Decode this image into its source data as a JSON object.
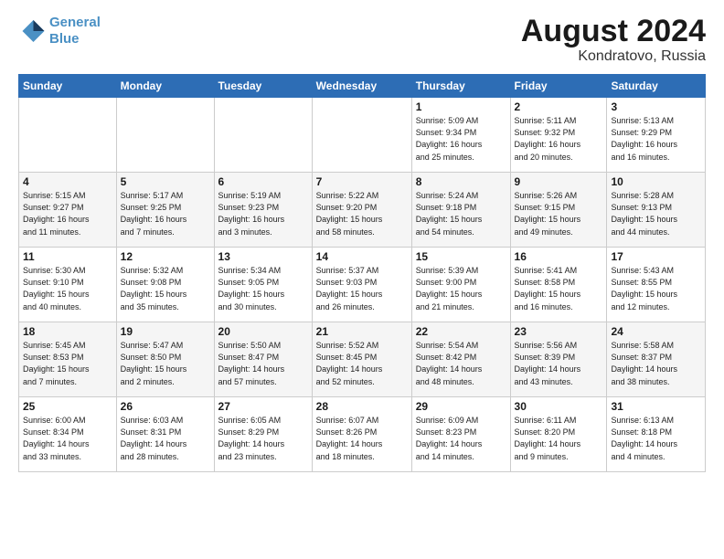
{
  "header": {
    "logo_line1": "General",
    "logo_line2": "Blue",
    "title": "August 2024",
    "subtitle": "Kondratovo, Russia"
  },
  "calendar": {
    "days_of_week": [
      "Sunday",
      "Monday",
      "Tuesday",
      "Wednesday",
      "Thursday",
      "Friday",
      "Saturday"
    ],
    "weeks": [
      [
        {
          "day": "",
          "info": ""
        },
        {
          "day": "",
          "info": ""
        },
        {
          "day": "",
          "info": ""
        },
        {
          "day": "",
          "info": ""
        },
        {
          "day": "1",
          "info": "Sunrise: 5:09 AM\nSunset: 9:34 PM\nDaylight: 16 hours\nand 25 minutes."
        },
        {
          "day": "2",
          "info": "Sunrise: 5:11 AM\nSunset: 9:32 PM\nDaylight: 16 hours\nand 20 minutes."
        },
        {
          "day": "3",
          "info": "Sunrise: 5:13 AM\nSunset: 9:29 PM\nDaylight: 16 hours\nand 16 minutes."
        }
      ],
      [
        {
          "day": "4",
          "info": "Sunrise: 5:15 AM\nSunset: 9:27 PM\nDaylight: 16 hours\nand 11 minutes."
        },
        {
          "day": "5",
          "info": "Sunrise: 5:17 AM\nSunset: 9:25 PM\nDaylight: 16 hours\nand 7 minutes."
        },
        {
          "day": "6",
          "info": "Sunrise: 5:19 AM\nSunset: 9:23 PM\nDaylight: 16 hours\nand 3 minutes."
        },
        {
          "day": "7",
          "info": "Sunrise: 5:22 AM\nSunset: 9:20 PM\nDaylight: 15 hours\nand 58 minutes."
        },
        {
          "day": "8",
          "info": "Sunrise: 5:24 AM\nSunset: 9:18 PM\nDaylight: 15 hours\nand 54 minutes."
        },
        {
          "day": "9",
          "info": "Sunrise: 5:26 AM\nSunset: 9:15 PM\nDaylight: 15 hours\nand 49 minutes."
        },
        {
          "day": "10",
          "info": "Sunrise: 5:28 AM\nSunset: 9:13 PM\nDaylight: 15 hours\nand 44 minutes."
        }
      ],
      [
        {
          "day": "11",
          "info": "Sunrise: 5:30 AM\nSunset: 9:10 PM\nDaylight: 15 hours\nand 40 minutes."
        },
        {
          "day": "12",
          "info": "Sunrise: 5:32 AM\nSunset: 9:08 PM\nDaylight: 15 hours\nand 35 minutes."
        },
        {
          "day": "13",
          "info": "Sunrise: 5:34 AM\nSunset: 9:05 PM\nDaylight: 15 hours\nand 30 minutes."
        },
        {
          "day": "14",
          "info": "Sunrise: 5:37 AM\nSunset: 9:03 PM\nDaylight: 15 hours\nand 26 minutes."
        },
        {
          "day": "15",
          "info": "Sunrise: 5:39 AM\nSunset: 9:00 PM\nDaylight: 15 hours\nand 21 minutes."
        },
        {
          "day": "16",
          "info": "Sunrise: 5:41 AM\nSunset: 8:58 PM\nDaylight: 15 hours\nand 16 minutes."
        },
        {
          "day": "17",
          "info": "Sunrise: 5:43 AM\nSunset: 8:55 PM\nDaylight: 15 hours\nand 12 minutes."
        }
      ],
      [
        {
          "day": "18",
          "info": "Sunrise: 5:45 AM\nSunset: 8:53 PM\nDaylight: 15 hours\nand 7 minutes."
        },
        {
          "day": "19",
          "info": "Sunrise: 5:47 AM\nSunset: 8:50 PM\nDaylight: 15 hours\nand 2 minutes."
        },
        {
          "day": "20",
          "info": "Sunrise: 5:50 AM\nSunset: 8:47 PM\nDaylight: 14 hours\nand 57 minutes."
        },
        {
          "day": "21",
          "info": "Sunrise: 5:52 AM\nSunset: 8:45 PM\nDaylight: 14 hours\nand 52 minutes."
        },
        {
          "day": "22",
          "info": "Sunrise: 5:54 AM\nSunset: 8:42 PM\nDaylight: 14 hours\nand 48 minutes."
        },
        {
          "day": "23",
          "info": "Sunrise: 5:56 AM\nSunset: 8:39 PM\nDaylight: 14 hours\nand 43 minutes."
        },
        {
          "day": "24",
          "info": "Sunrise: 5:58 AM\nSunset: 8:37 PM\nDaylight: 14 hours\nand 38 minutes."
        }
      ],
      [
        {
          "day": "25",
          "info": "Sunrise: 6:00 AM\nSunset: 8:34 PM\nDaylight: 14 hours\nand 33 minutes."
        },
        {
          "day": "26",
          "info": "Sunrise: 6:03 AM\nSunset: 8:31 PM\nDaylight: 14 hours\nand 28 minutes."
        },
        {
          "day": "27",
          "info": "Sunrise: 6:05 AM\nSunset: 8:29 PM\nDaylight: 14 hours\nand 23 minutes."
        },
        {
          "day": "28",
          "info": "Sunrise: 6:07 AM\nSunset: 8:26 PM\nDaylight: 14 hours\nand 18 minutes."
        },
        {
          "day": "29",
          "info": "Sunrise: 6:09 AM\nSunset: 8:23 PM\nDaylight: 14 hours\nand 14 minutes."
        },
        {
          "day": "30",
          "info": "Sunrise: 6:11 AM\nSunset: 8:20 PM\nDaylight: 14 hours\nand 9 minutes."
        },
        {
          "day": "31",
          "info": "Sunrise: 6:13 AM\nSunset: 8:18 PM\nDaylight: 14 hours\nand 4 minutes."
        }
      ]
    ]
  }
}
